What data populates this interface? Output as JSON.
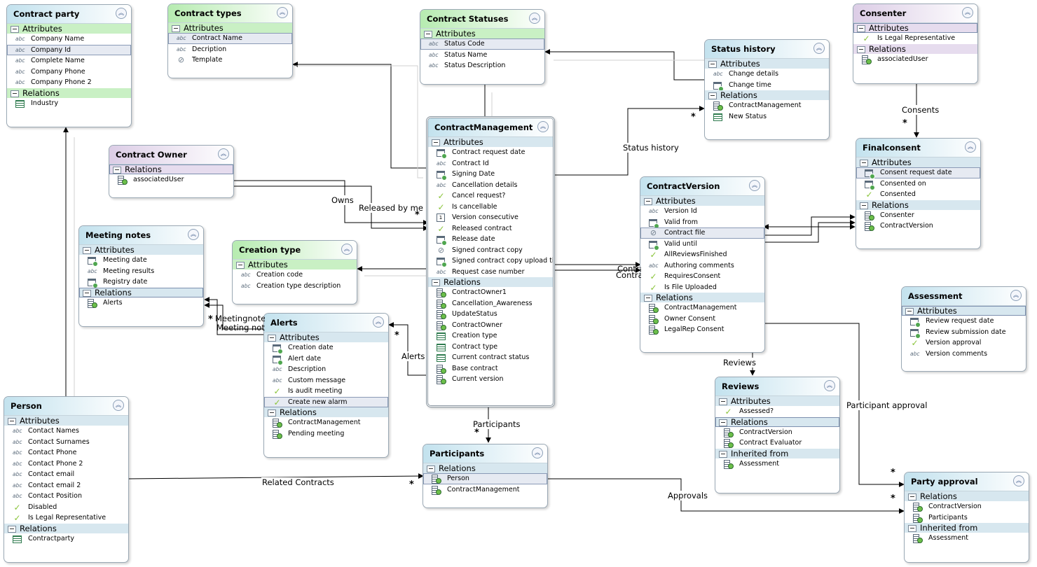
{
  "entities": [
    {
      "id": "contract-party",
      "title": "Contract party",
      "color": "blue",
      "sections": [
        {
          "label": "Attributes",
          "color": "green",
          "rows": [
            {
              "icon": "abc",
              "text": "Company Name"
            },
            {
              "icon": "abc",
              "text": "Company Id",
              "selected": true
            },
            {
              "icon": "abc",
              "text": "Complete Name"
            },
            {
              "icon": "abc",
              "text": "Company Phone"
            },
            {
              "icon": "abc",
              "text": "Company Phone 2"
            }
          ]
        },
        {
          "label": "Relations",
          "color": "green",
          "rows": [
            {
              "icon": "table",
              "text": "Industry"
            }
          ]
        }
      ]
    },
    {
      "id": "contract-types",
      "title": "Contract types",
      "color": "green",
      "sections": [
        {
          "label": "Attributes",
          "color": "green",
          "rows": [
            {
              "icon": "abc",
              "text": "Contract Name",
              "selected": true
            },
            {
              "icon": "abc",
              "text": "Decription"
            },
            {
              "icon": "clip",
              "text": "Template"
            }
          ]
        }
      ]
    },
    {
      "id": "contract-statuses",
      "title": "Contract Statuses",
      "color": "green",
      "sections": [
        {
          "label": "Attributes",
          "color": "green",
          "rows": [
            {
              "icon": "abc",
              "text": "Status Code",
              "selected": true
            },
            {
              "icon": "abc",
              "text": "Status Name"
            },
            {
              "icon": "abc",
              "text": "Status Description"
            }
          ]
        }
      ]
    },
    {
      "id": "status-history",
      "title": "Status history",
      "color": "blue",
      "sections": [
        {
          "label": "Attributes",
          "color": "blue",
          "rows": [
            {
              "icon": "abc",
              "text": "Change details"
            },
            {
              "icon": "cal",
              "text": "Change time"
            }
          ]
        },
        {
          "label": "Relations",
          "color": "blue",
          "rows": [
            {
              "icon": "rel",
              "text": "ContractManagement"
            },
            {
              "icon": "table",
              "text": "New Status"
            }
          ]
        }
      ]
    },
    {
      "id": "consenter",
      "title": "Consenter",
      "color": "purple",
      "sections": [
        {
          "label": "Attributes",
          "color": "purple",
          "selected": true,
          "rows": [
            {
              "icon": "check",
              "text": "Is Legal Representative"
            }
          ]
        },
        {
          "label": "Relations",
          "color": "purple",
          "rows": [
            {
              "icon": "rel",
              "text": "associatedUser"
            }
          ]
        }
      ]
    },
    {
      "id": "contract-owner",
      "title": "Contract Owner",
      "color": "purple",
      "sections": [
        {
          "label": "Relations",
          "color": "purple",
          "selected": true,
          "rows": [
            {
              "icon": "rel",
              "text": "associatedUser"
            }
          ]
        }
      ]
    },
    {
      "id": "contract-management",
      "title": "ContractManagement",
      "color": "blue",
      "main": true,
      "sections": [
        {
          "label": "Attributes",
          "color": "blue",
          "rows": [
            {
              "icon": "cal",
              "text": "Contract request date"
            },
            {
              "icon": "abc",
              "text": "Contract Id"
            },
            {
              "icon": "cal",
              "text": "Signing Date"
            },
            {
              "icon": "abc",
              "text": "Cancellation details"
            },
            {
              "icon": "check",
              "text": "Cancel request?"
            },
            {
              "icon": "check",
              "text": "Is cancellable"
            },
            {
              "icon": "num",
              "text": "Version consecutive"
            },
            {
              "icon": "check",
              "text": "Released contract"
            },
            {
              "icon": "cal",
              "text": "Release date"
            },
            {
              "icon": "clip",
              "text": "Signed contract copy"
            },
            {
              "icon": "cal",
              "text": "Signed contract copy upload time"
            },
            {
              "icon": "abc",
              "text": "Request case number"
            }
          ]
        },
        {
          "label": "Relations",
          "color": "blue",
          "rows": [
            {
              "icon": "rel",
              "text": "ContractOwner1"
            },
            {
              "icon": "rel",
              "text": "Cancellation_Awareness"
            },
            {
              "icon": "rel",
              "text": "UpdateStatus"
            },
            {
              "icon": "rel",
              "text": "ContractOwner"
            },
            {
              "icon": "table",
              "text": "Creation type"
            },
            {
              "icon": "table",
              "text": "Contract type"
            },
            {
              "icon": "table",
              "text": "Current contract status"
            },
            {
              "icon": "rel",
              "text": "Base contract"
            },
            {
              "icon": "rel",
              "text": "Current version"
            }
          ]
        }
      ]
    },
    {
      "id": "final-consent",
      "title": "Finalconsent",
      "color": "blue",
      "sections": [
        {
          "label": "Attributes",
          "color": "blue",
          "rows": [
            {
              "icon": "cal",
              "text": "Consent request date",
              "selected": true
            },
            {
              "icon": "cal",
              "text": "Consented on"
            },
            {
              "icon": "check",
              "text": "Consented"
            }
          ]
        },
        {
          "label": "Relations",
          "color": "blue",
          "rows": [
            {
              "icon": "rel",
              "text": "Consenter"
            },
            {
              "icon": "rel",
              "text": "ContractVersion"
            }
          ]
        }
      ]
    },
    {
      "id": "contract-version",
      "title": "ContractVersion",
      "color": "blue",
      "sections": [
        {
          "label": "Attributes",
          "color": "blue",
          "rows": [
            {
              "icon": "abc",
              "text": "Version Id"
            },
            {
              "icon": "cal",
              "text": "Valid from"
            },
            {
              "icon": "clip",
              "text": "Contract file",
              "selected": true
            },
            {
              "icon": "cal",
              "text": "Valid until"
            },
            {
              "icon": "check",
              "text": "AllReviewsFinished"
            },
            {
              "icon": "abc",
              "text": "Authoring comments"
            },
            {
              "icon": "check",
              "text": "RequiresConsent"
            },
            {
              "icon": "check",
              "text": "Is File Uploaded"
            }
          ]
        },
        {
          "label": "Relations",
          "color": "blue",
          "rows": [
            {
              "icon": "rel",
              "text": "ContractManagement"
            },
            {
              "icon": "rel",
              "text": "Owner Consent"
            },
            {
              "icon": "rel",
              "text": "LegalRep Consent"
            }
          ]
        }
      ]
    },
    {
      "id": "meeting-notes",
      "title": "Meeting notes",
      "color": "blue",
      "sections": [
        {
          "label": "Attributes",
          "color": "blue",
          "rows": [
            {
              "icon": "cal",
              "text": "Meeting date"
            },
            {
              "icon": "abc",
              "text": "Meeting results"
            },
            {
              "icon": "cal",
              "text": "Registry date"
            }
          ]
        },
        {
          "label": "Relations",
          "color": "blue",
          "selected": true,
          "rows": [
            {
              "icon": "rel",
              "text": "Alerts"
            }
          ]
        }
      ]
    },
    {
      "id": "creation-type",
      "title": "Creation type",
      "color": "green",
      "sections": [
        {
          "label": "Attributes",
          "color": "green",
          "rows": [
            {
              "icon": "abc",
              "text": "Creation code"
            },
            {
              "icon": "abc",
              "text": "Creation type description"
            }
          ]
        }
      ]
    },
    {
      "id": "alerts",
      "title": "Alerts",
      "color": "blue",
      "sections": [
        {
          "label": "Attributes",
          "color": "blue",
          "rows": [
            {
              "icon": "cal",
              "text": "Creation date"
            },
            {
              "icon": "cal",
              "text": "Alert date"
            },
            {
              "icon": "abc",
              "text": "Description"
            },
            {
              "icon": "abc",
              "text": "Custom message"
            },
            {
              "icon": "check",
              "text": "Is audit meeting"
            },
            {
              "icon": "check",
              "text": "Create new alarm",
              "selected": true
            }
          ]
        },
        {
          "label": "Relations",
          "color": "blue",
          "rows": [
            {
              "icon": "rel",
              "text": "ContractManagement"
            },
            {
              "icon": "rel",
              "text": "Pending meeting"
            }
          ]
        }
      ]
    },
    {
      "id": "assessment",
      "title": "Assessment",
      "color": "blue",
      "sections": [
        {
          "label": "Attributes",
          "color": "blue",
          "selected": true,
          "rows": [
            {
              "icon": "cal",
              "text": "Review request date"
            },
            {
              "icon": "cal",
              "text": "Review submission date"
            },
            {
              "icon": "check",
              "text": "Version approval"
            },
            {
              "icon": "abc",
              "text": "Version comments"
            }
          ]
        }
      ]
    },
    {
      "id": "reviews",
      "title": "Reviews",
      "color": "blue",
      "sections": [
        {
          "label": "Attributes",
          "color": "blue",
          "rows": [
            {
              "icon": "check",
              "text": "Assessed?"
            }
          ]
        },
        {
          "label": "Relations",
          "color": "blue",
          "selected": true,
          "rows": [
            {
              "icon": "rel",
              "text": "ContractVersion"
            },
            {
              "icon": "rel",
              "text": "Contract Evaluator"
            }
          ]
        },
        {
          "label": "Inherited from",
          "color": "blue",
          "rows": [
            {
              "icon": "rel",
              "text": "Assessment"
            }
          ]
        }
      ]
    },
    {
      "id": "person",
      "title": "Person",
      "color": "blue",
      "sections": [
        {
          "label": "Attributes",
          "color": "blue",
          "rows": [
            {
              "icon": "abc",
              "text": "Contact Names"
            },
            {
              "icon": "abc",
              "text": "Contact Surnames"
            },
            {
              "icon": "abc",
              "text": "Contact Phone"
            },
            {
              "icon": "abc",
              "text": "Contact Phone 2"
            },
            {
              "icon": "abc",
              "text": "Contact email"
            },
            {
              "icon": "abc",
              "text": "Contact email 2"
            },
            {
              "icon": "abc",
              "text": "Contact Position"
            },
            {
              "icon": "check",
              "text": "Disabled"
            },
            {
              "icon": "check",
              "text": "Is Legal Representative"
            }
          ]
        },
        {
          "label": "Relations",
          "color": "blue",
          "rows": [
            {
              "icon": "table",
              "text": "Contractparty"
            }
          ]
        }
      ]
    },
    {
      "id": "participants",
      "title": "Participants",
      "color": "blue",
      "sections": [
        {
          "label": "Relations",
          "color": "blue",
          "rows": [
            {
              "icon": "rel",
              "text": "Person",
              "selected": true
            },
            {
              "icon": "rel",
              "text": "ContractManagement"
            }
          ]
        }
      ]
    },
    {
      "id": "party-approval",
      "title": "Party approval",
      "color": "blue",
      "sections": [
        {
          "label": "Relations",
          "color": "blue",
          "rows": [
            {
              "icon": "rel",
              "text": "ContractVersion"
            },
            {
              "icon": "rel",
              "text": "Participants"
            }
          ]
        },
        {
          "label": "Inherited from",
          "color": "blue",
          "rows": [
            {
              "icon": "rel",
              "text": "Assessment"
            }
          ]
        }
      ]
    }
  ],
  "connection_labels": {
    "owns": "Owns",
    "released_by_me": "Released by me",
    "status_history": "Status history",
    "consents": "Consents",
    "meetingnotes": "Meetingnotes",
    "meeting_notes": "Meeting notes",
    "alerts": "Alerts",
    "contra_1": "Contra",
    "contra_2": "Contra",
    "participants": "Participants",
    "related_contracts": "Related Contracts",
    "approvals": "Approvals",
    "reviews": "Reviews",
    "participant_approval": "Participant approval"
  },
  "multiplicity_marker": "*"
}
